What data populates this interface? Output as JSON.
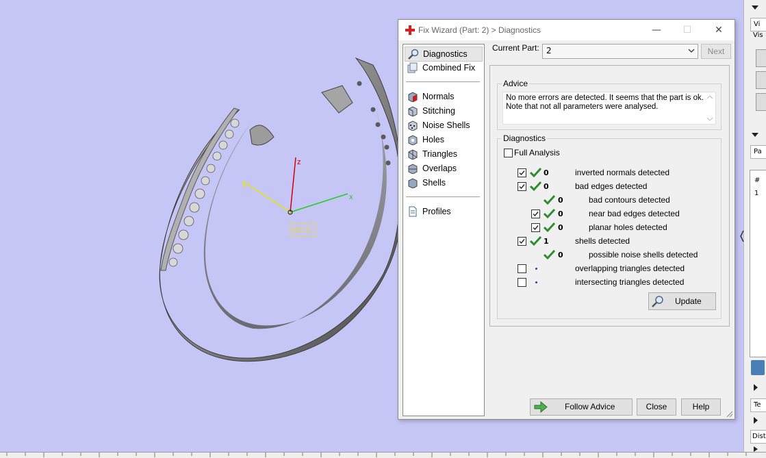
{
  "dialog": {
    "title": "Fix Wizard (Part: 2) > Diagnostics",
    "minimize_glyph": "—",
    "maximize_glyph": "☐",
    "close_glyph": "✕"
  },
  "viewport": {
    "wcs_label": "WCS",
    "axis_x": "x",
    "axis_z": "z",
    "axis_y": "y"
  },
  "nav": {
    "items": [
      {
        "label": "Diagnostics",
        "icon": "magnifier-icon"
      },
      {
        "label": "Combined Fix",
        "icon": "stacked-layers-icon"
      },
      {
        "label": "Normals",
        "icon": "normals-cube-icon"
      },
      {
        "label": "Stitching",
        "icon": "stitching-cube-icon"
      },
      {
        "label": "Noise Shells",
        "icon": "noise-shells-icon"
      },
      {
        "label": "Holes",
        "icon": "holes-cube-icon"
      },
      {
        "label": "Triangles",
        "icon": "triangles-cube-icon"
      },
      {
        "label": "Overlaps",
        "icon": "overlaps-cube-icon"
      },
      {
        "label": "Shells",
        "icon": "shells-cube-icon"
      },
      {
        "label": "Profiles",
        "icon": "document-icon"
      }
    ]
  },
  "current_part": {
    "label": "Current Part:",
    "value": "2",
    "next_label": "Next"
  },
  "advice": {
    "title": "Advice",
    "text": "No more errors are detected. It seems that the part is ok. Note that not all parameters were analysed."
  },
  "diagnostics": {
    "title": "Diagnostics",
    "full_analysis_label": "Full Analysis",
    "rows": [
      {
        "checkbox": true,
        "checked": true,
        "status": "ok",
        "value": "0",
        "label": "inverted normals detected",
        "indent": 0
      },
      {
        "checkbox": true,
        "checked": true,
        "status": "ok",
        "value": "0",
        "label": "bad edges detected",
        "indent": 0
      },
      {
        "checkbox": false,
        "checked": false,
        "status": "ok",
        "value": "0",
        "label": "bad contours detected",
        "indent": 1
      },
      {
        "checkbox": true,
        "checked": true,
        "status": "ok",
        "value": "0",
        "label": "near bad edges detected",
        "indent": 1
      },
      {
        "checkbox": true,
        "checked": true,
        "status": "ok",
        "value": "0",
        "label": "planar holes detected",
        "indent": 1
      },
      {
        "checkbox": true,
        "checked": true,
        "status": "ok",
        "value": "1",
        "label": "shells detected",
        "indent": 0
      },
      {
        "checkbox": false,
        "checked": false,
        "status": "ok",
        "value": "0",
        "label": "possible noise shells detected",
        "indent": 1
      },
      {
        "checkbox": true,
        "checked": false,
        "status": "pending",
        "value": "",
        "label": "overlapping triangles detected",
        "indent": 0
      },
      {
        "checkbox": true,
        "checked": false,
        "status": "pending",
        "value": "",
        "label": "intersecting triangles detected",
        "indent": 0
      }
    ],
    "update_label": "Update"
  },
  "footer": {
    "follow_advice_label": "Follow Advice",
    "close_label": "Close",
    "help_label": "Help"
  },
  "right_panel": {
    "tab1": "Vi",
    "group1": "Vis",
    "tab2": "Pa",
    "col_hash": "#",
    "row1": "1",
    "tab3": "Te",
    "tab4": "Dist"
  },
  "colors": {
    "viewport_bg": "#c6c6f6",
    "check_green": "#2e8b2e",
    "axis_x": "#22cc22",
    "axis_y": "#e6e600",
    "axis_z": "#d00000",
    "wcs": "#e6d54a"
  }
}
